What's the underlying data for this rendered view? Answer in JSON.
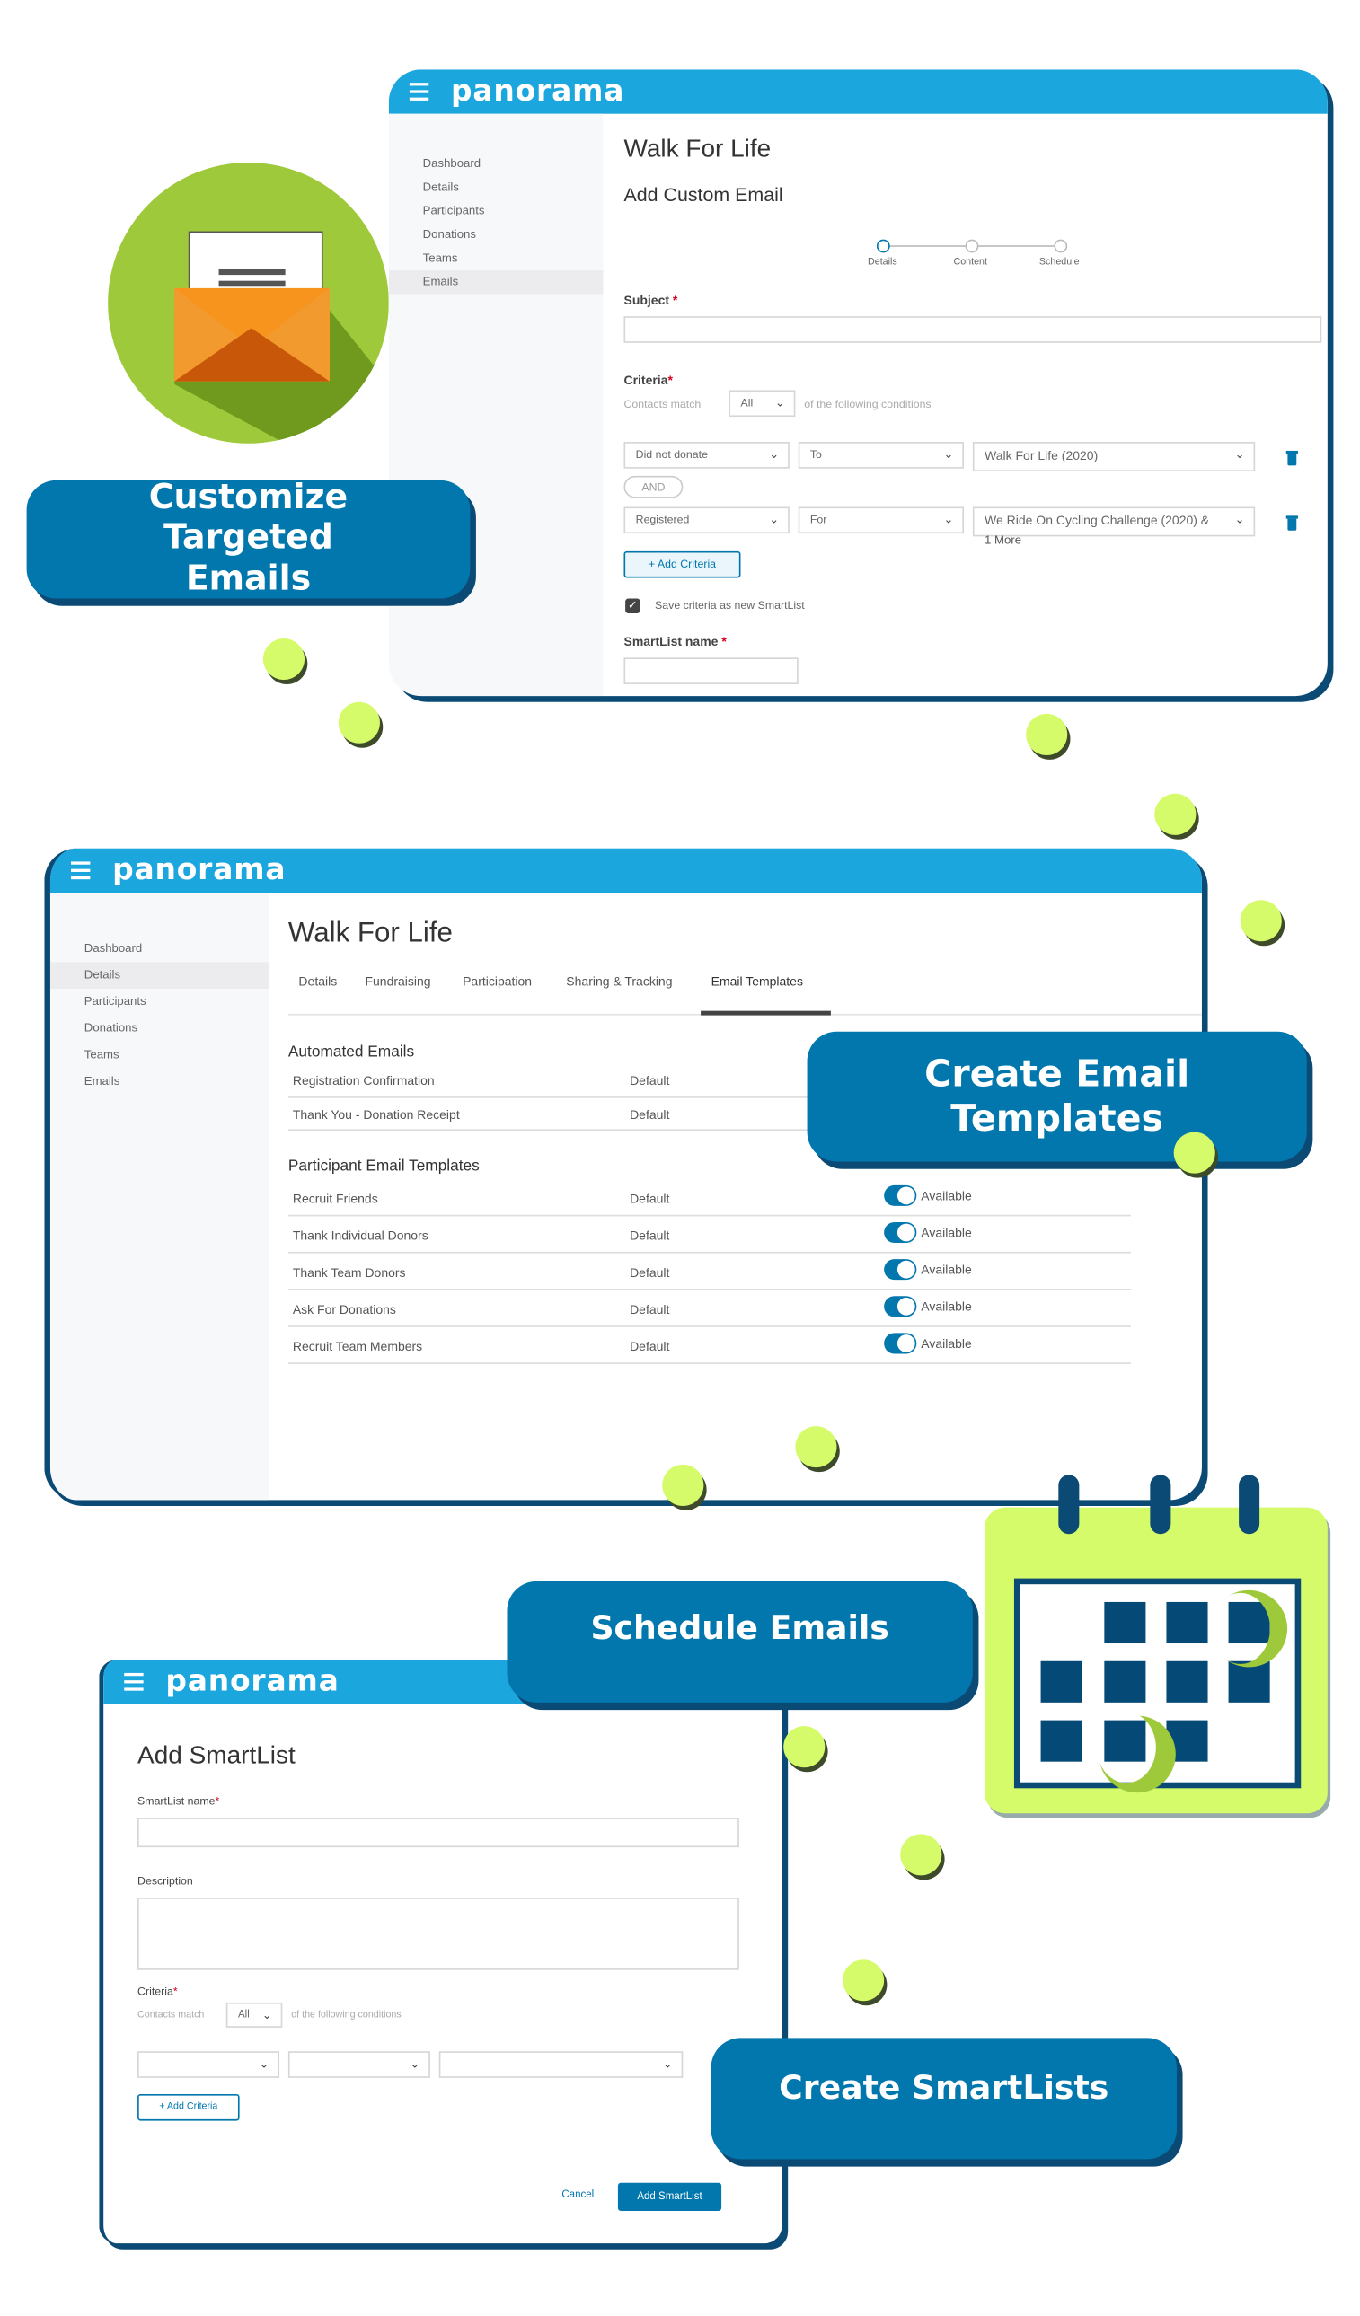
{
  "brand": {
    "logo": "panorama",
    "accent": "#1ca6de",
    "primary": "#0277ad",
    "dark": "#0b4a75",
    "lime": "#d6fb6a"
  },
  "badges": {
    "customize": "Customize Targeted Emails",
    "templates": "Create Email Templates",
    "schedule": "Schedule Emails",
    "smartlists": "Create SmartLists"
  },
  "custom_email": {
    "sidebar": [
      "Dashboard",
      "Details",
      "Participants",
      "Donations",
      "Teams",
      "Emails"
    ],
    "active_nav": "Emails",
    "title": "Walk For Life",
    "subtitle": "Add Custom Email",
    "steps": [
      "Details",
      "Content",
      "Schedule"
    ],
    "subject_label": "Subject",
    "subject_value": "",
    "criteria_label": "Criteria",
    "contacts_match": "Contacts match",
    "match_value": "All",
    "following": "of the following conditions",
    "rows": [
      {
        "a": "Did not donate",
        "b": "To",
        "c": "Walk For Life (2020)",
        "extra": ""
      },
      {
        "a": "Registered",
        "b": "For",
        "c": "We Ride On Cycling Challenge (2020) &",
        "extra": "1 More"
      }
    ],
    "and_label": "AND",
    "add_criteria": "+ Add Criteria",
    "save_checkbox": "Save criteria as new SmartList",
    "save_checked": true,
    "smartlist_label": "SmartList name",
    "smartlist_value": ""
  },
  "templates": {
    "sidebar": [
      "Dashboard",
      "Details",
      "Participants",
      "Donations",
      "Teams",
      "Emails"
    ],
    "active_nav": "Details",
    "title": "Walk For Life",
    "tabs": [
      "Details",
      "Fundraising",
      "Participation",
      "Sharing & Tracking",
      "Email Templates"
    ],
    "active_tab": "Email Templates",
    "automated_heading": "Automated Emails",
    "automated": [
      {
        "name": "Registration Confirmation",
        "type": "Default"
      },
      {
        "name": "Thank You - Donation Receipt",
        "type": "Default"
      }
    ],
    "participant_heading": "Participant Email Templates",
    "participant": [
      {
        "name": "Recruit Friends",
        "type": "Default",
        "status": "Available",
        "on": true
      },
      {
        "name": "Thank Individual Donors",
        "type": "Default",
        "status": "Available",
        "on": true
      },
      {
        "name": "Thank Team Donors",
        "type": "Default",
        "status": "Available",
        "on": true
      },
      {
        "name": "Ask For Donations",
        "type": "Default",
        "status": "Available",
        "on": true
      },
      {
        "name": "Recruit Team Members",
        "type": "Default",
        "status": "Available",
        "on": true
      }
    ]
  },
  "smartlist": {
    "title": "Add SmartList",
    "name_label": "SmartList name",
    "desc_label": "Description",
    "criteria_label": "Criteria",
    "contacts_match": "Contacts match",
    "match_value": "All",
    "following": "of the following conditions",
    "add_criteria": "+ Add Criteria",
    "cancel": "Cancel",
    "submit": "Add SmartList"
  }
}
